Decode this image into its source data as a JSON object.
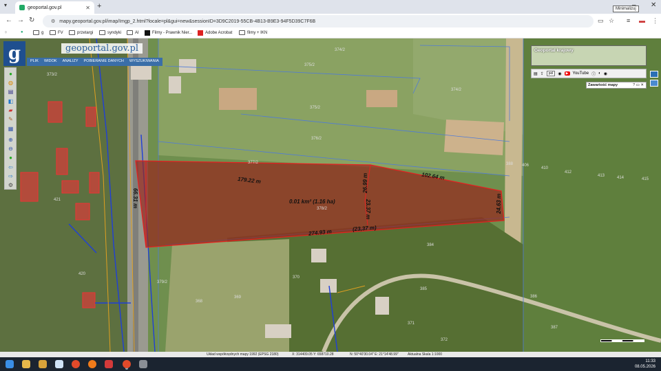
{
  "browser": {
    "tab_title": "geoportal.gov.pl",
    "url": "mapy.geoportal.gov.pl/imap/Imgp_2.html?locale=pl&gui=new&sessionID=3D9C2019-55CB-4B13-B9E3-94F5D39C7F6B",
    "tooltip": "Minimalizuj",
    "bookmarks": [
      "g",
      "FV",
      "przetargi",
      "syndyki",
      "AI",
      "Filmy - Prawnik Nier...",
      "Adobe Acrobat",
      "filmy + IKN"
    ]
  },
  "geoportal": {
    "logo": "g",
    "title": "geoportal.gov.pl",
    "menu": [
      "PLIK",
      "WIDOK",
      "ANALIZY",
      "POBIERANIE DANYCH",
      "WYSZUKIWANIA"
    ],
    "minimap_title": "Geoportal krajowy",
    "lang": "pol",
    "youtube": "YouTube",
    "contents_title": "Zawartość mapy"
  },
  "measurements": {
    "area": "0.01 km² (1.16 ha)",
    "top_left": "179.22 m",
    "top_right": "102.64 m",
    "left": "66.31 m",
    "right": "24.63 m",
    "mid_upper": "26.99 m",
    "mid_lower": "23.37 m",
    "bottom": "274.93 m",
    "bottom_paren": "(23,37 m)"
  },
  "parcel_labels": [
    "374/2",
    "375/2",
    "375/2",
    "374/2",
    "376/2",
    "377/2",
    "378/2",
    "379/2",
    "373/2",
    "368",
    "369",
    "370",
    "371",
    "372",
    "384",
    "385",
    "386",
    "387",
    "388",
    "406",
    "410",
    "412",
    "413",
    "414",
    "415",
    "420",
    "421"
  ],
  "status": {
    "crs": "Układ współrzędnych mapy 1992 (EPSG 2180)",
    "coords_xy": "X: 314409.05 Y: 658710.28",
    "coords_ne": "N: 50°40'30.04\" E: 21°14'48.99\"",
    "scale": "Aktualna Skala 1:1000"
  },
  "taskbar": {
    "time": "11:33",
    "date": "08.05.2026"
  }
}
